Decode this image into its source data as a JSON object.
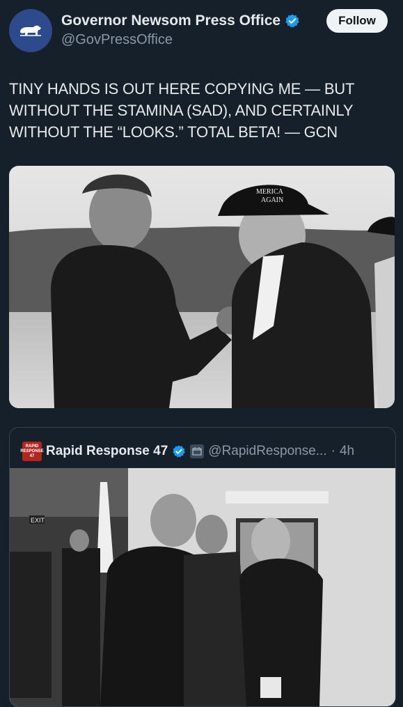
{
  "post": {
    "author_name": "Governor Newsom Press Office",
    "author_handle": "@GovPressOffice",
    "follow_label": "Follow",
    "text": "TINY HANDS IS OUT HERE COPYING ME — BUT WITHOUT THE STAMINA (SAD), AND CERTAINLY WITHOUT THE “LOOKS.” TOTAL BETA! — GCN"
  },
  "photo1": {
    "hat_line1": "MERICA",
    "hat_line2": "AGAIN"
  },
  "quote": {
    "author_name": "Rapid Response 47",
    "avatar_text_1": "RAPID",
    "avatar_text_2": "RESPONSE",
    "avatar_text_3": "47",
    "author_handle": "@RapidResponse...",
    "separator": "·",
    "time": "4h",
    "exit_sign": "EXIT"
  },
  "colors": {
    "background": "#15202b",
    "verified": "#1d9bf0",
    "follow_bg": "#eff3f4",
    "muted_text": "#8b98a5"
  },
  "icons": {
    "avatar": "california-bear-icon",
    "verified": "verified-badge-icon"
  }
}
